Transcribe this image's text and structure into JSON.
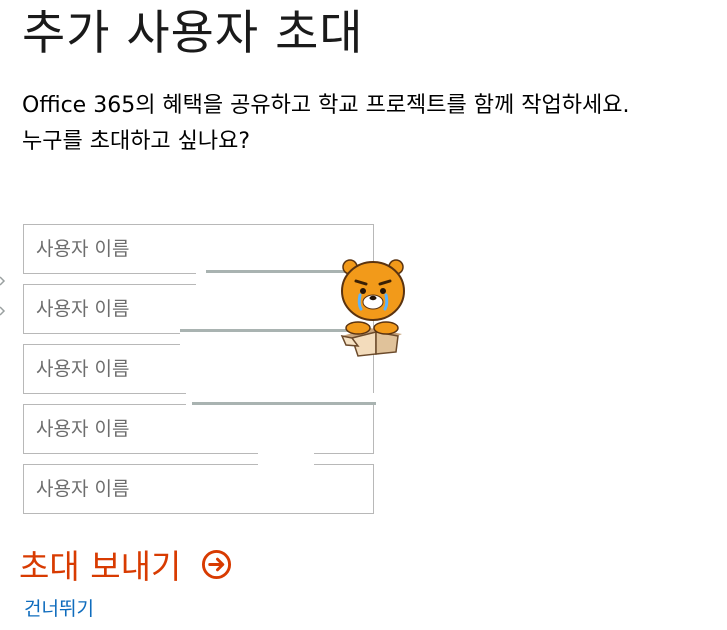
{
  "page": {
    "title": "추가 사용자 초대",
    "intro_line1": "Office 365의 혜택을 공유하고 학교 프로젝트를 함께 작업하세요.",
    "intro_line2": "누구를 초대하고 싶나요?"
  },
  "form": {
    "fields": [
      {
        "placeholder": "사용자 이름",
        "value": ""
      },
      {
        "placeholder": "사용자 이름",
        "value": ""
      },
      {
        "placeholder": "사용자 이름",
        "value": ""
      },
      {
        "placeholder": "사용자 이름",
        "value": ""
      },
      {
        "placeholder": "사용자 이름",
        "value": ""
      }
    ]
  },
  "actions": {
    "send_label": "초대 보내기",
    "send_icon": "arrow-right-circle-icon",
    "skip_label": "건너뛰기"
  },
  "colors": {
    "accent": "#d83b01",
    "link": "#0f6cbd",
    "field_border": "#b8b8b8"
  }
}
